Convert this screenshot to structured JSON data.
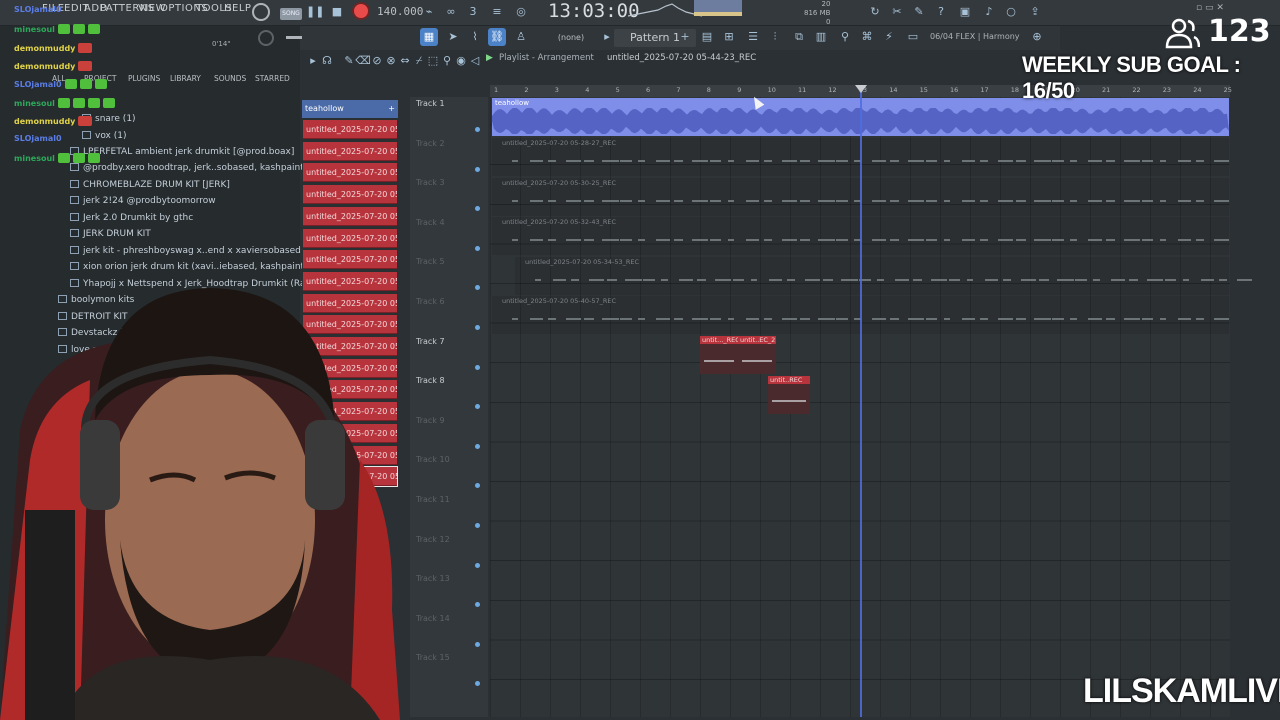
{
  "menu": {
    "items": [
      "FILE",
      "EDIT",
      "ADD",
      "PATTERNS",
      "VIEW",
      "OPTIONS",
      "TOOLS",
      "HELP"
    ],
    "mode": "SONG",
    "bpm": "140.000",
    "time": "13:03:00",
    "cpu": [
      "20",
      "816 MB",
      "0"
    ]
  },
  "toolbar2": {
    "pattern_selector": "(none)",
    "pattern": "Pattern 1",
    "plugin_info": "06/04  FLEX | Harmony"
  },
  "browser": {
    "tabs": [
      "ALL",
      "PROJECT",
      "PLUGINS",
      "LIBRARY",
      "SOUNDS",
      "STARRED"
    ],
    "zoom": "0'14\"",
    "items": [
      "snare (1)",
      "vox (1)",
      "LPERFETAL ambient jerk drumkit [@prod.boax]",
      "@prodby.xero hoodtrap, jerk..sobased, kashpaint drum kit",
      "CHROMEBLAZE DRUM KIT [JERK]",
      "jerk 2!24 @prodbytoomorrow",
      "Jerk 2.0 Drumkit by gthc",
      "JERK DRUM KIT",
      "jerk kit - phreshboyswag x..end x xaviersobased drum kit",
      "xion orion jerk drum kit (xavi..iebased, kashpaint jerk kit)",
      "Yhapojj x Nettspend x Jerk_Hoodtrap Drumkit (Rare Shit)",
      "boolymon kits",
      "DETROIT KIT",
      "Devstackz k",
      "love m"
    ]
  },
  "chat": [
    {
      "user": "SLOjamal0",
      "color": "#5a7de6"
    },
    {
      "user": "minesoul",
      "color": "#2ea85a"
    },
    {
      "user": "demonmuddy",
      "color": "#e0d347"
    },
    {
      "user": "demonmuddy",
      "color": "#e0d347"
    },
    {
      "user": "SLOjamal0",
      "color": "#5a7de6"
    },
    {
      "user": "minesoul",
      "color": "#2ea85a"
    },
    {
      "user": "demonmuddy",
      "color": "#e0d347"
    },
    {
      "user": "SLOjamal0",
      "color": "#5a7de6"
    },
    {
      "user": "minesoul",
      "color": "#2ea85a"
    }
  ],
  "picker": {
    "header": "teahollow",
    "clips": [
      "untitled_2025-07-20 05...",
      "untitled_2025-07-20 05...",
      "untitled_2025-07-20 05...",
      "untitled_2025-07-20 05...",
      "untitled_2025-07-20 05...",
      "untitled_2025-07-20 05...",
      "untitled_2025-07-20 05...",
      "untitled_2025-07-20 05...",
      "untitled_2025-07-20 05...",
      "untitled_2025-07-20 05...",
      "untitled_2025-07-20 05...",
      "untitled_2025-07-20 05...",
      "untitled_2025-07-20 05...",
      "untitled_2025-07-20 05...",
      "untitled_2025-07-20 05...",
      "untitled_2025-07-20 05...",
      "untitled_2025-07-20 05..."
    ]
  },
  "playlist": {
    "title": "Playlist - Arrangement",
    "file": "untitled_2025-07-20 05-44-23_REC",
    "ruler": [
      "1",
      "2",
      "3",
      "4",
      "5",
      "6",
      "7",
      "8",
      "9",
      "10",
      "11",
      "12",
      "13",
      "14",
      "15",
      "16",
      "17",
      "18",
      "19",
      "20",
      "21",
      "22",
      "23",
      "24",
      "25"
    ],
    "tracks": [
      "Track 1",
      "Track 2",
      "Track 3",
      "Track 4",
      "Track 5",
      "Track 6",
      "Track 7",
      "Track 8",
      "Track 9",
      "Track 10",
      "Track 11",
      "Track 12",
      "Track 13",
      "Track 14",
      "Track 15"
    ],
    "track1_clip": "teahollow",
    "rec_clips": [
      "untitled_2025-07-20 05-28-27_REC",
      "untitled_2025-07-20 05-30-25_REC",
      "untitled_2025-07-20 05-32-43_REC",
      "untitled_2025-07-20 05-34-53_REC",
      "untitled_2025-07-20 05-40-57_REC"
    ],
    "red_clips": [
      "untit..._REC",
      "untit..EC_2",
      "untit..REC"
    ]
  },
  "overlay": {
    "viewers": "123",
    "sub_goal": "WEEKLY SUB GOAL : 16/50",
    "channel": "LILSKAMLIVE"
  },
  "colors": {
    "accent": "#4b82c8",
    "audio_clip": "#7f8ee8",
    "picker_clip": "#b8343d",
    "playhead": "#4f6de0"
  }
}
